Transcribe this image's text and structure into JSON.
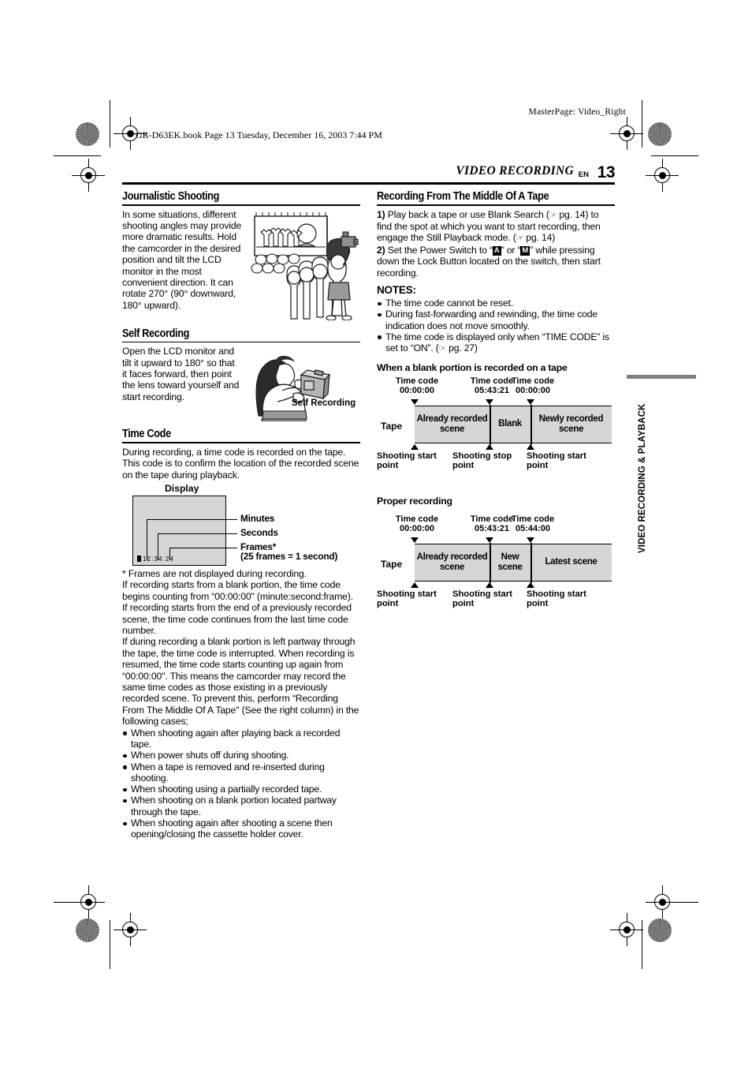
{
  "printer": {
    "masterpage": "MasterPage: Video_Right",
    "bookline": "GR-D63EK.book  Page 13  Tuesday, December 16, 2003  7:44 PM"
  },
  "header": {
    "title": "VIDEO RECORDING",
    "lang": "EN",
    "page_number": "13"
  },
  "sidetab": {
    "label": "VIDEO RECORDING & PLAYBACK",
    "color": "#808080"
  },
  "left_column": {
    "journalistic": {
      "heading": "Journalistic Shooting",
      "body": "In some situations, different shooting angles may provide more dramatic results. Hold the camcorder in the desired position and tilt the LCD monitor in the most convenient direction. It can rotate 270° (90° downward, 180° upward).",
      "illustration": "crowd-filming-illustration"
    },
    "self_recording": {
      "heading": "Self Recording",
      "body": "Open the LCD monitor and tilt it upward to 180° so that it faces forward, then point the lens toward yourself and start recording.",
      "illustration": "woman-with-camcorder-illustration",
      "caption": "Self Recording"
    },
    "time_code": {
      "heading": "Time Code",
      "intro": "During recording, a time code is recorded on the tape. This code is to confirm the location of the recorded scene on the tape during playback.",
      "display_label": "Display",
      "display_value": "12:34:24",
      "callouts": [
        {
          "label": "Minutes"
        },
        {
          "label": "Seconds"
        },
        {
          "label": "Frames*",
          "sub": "(25 frames = 1 second)"
        }
      ],
      "footnote": "*   Frames are not displayed during recording.",
      "para1": "If recording starts from a blank portion, the time code begins counting from “00:00:00\" (minute:second:frame). If recording starts from the end of a previously recorded scene, the time code continues from the last time code number.",
      "para2": "If during recording a blank portion is left partway through the tape, the time code is interrupted. When recording is resumed, the time code starts counting up again from “00:00:00\". This means the camcorder may record the same time codes as those existing in a previously recorded scene. To prevent this, perform “Recording From The Middle Of A Tape\" (See the right column) in the following cases;",
      "cases": [
        "When shooting again after playing back a recorded tape.",
        "When power shuts off during shooting.",
        "When a tape is removed and re-inserted during shooting.",
        "When shooting using a partially recorded tape.",
        "When shooting on a blank portion located partway through the tape.",
        "When shooting again after shooting a scene then opening/closing the cassette holder cover."
      ]
    }
  },
  "right_column": {
    "recording_middle": {
      "heading": "Recording From The Middle Of A Tape",
      "step1_num": "1)",
      "step1_a": " Play back a tape or use Blank Search (",
      "step1_b": " pg. 14) to find the spot at which you want to start recording, then engage the Still Playback mode. (",
      "step1_c": " pg. 14)",
      "step2_num": "2)",
      "step2_a": " Set the Power Switch to “",
      "step2_key1": "A",
      "step2_b": "” or “",
      "step2_key2": "M",
      "step2_c": "” while pressing down the Lock Button located on the switch, then start recording."
    },
    "notes": {
      "heading": "NOTES:",
      "items": [
        "The time code cannot be reset.",
        "During fast-forwarding and rewinding, the time code indication does not move smoothly."
      ],
      "item3_a": "The time code is displayed only when “TIME CODE” is set to “ON”. (",
      "item3_b": " pg. 27)"
    },
    "diagram_blank": {
      "heading": "When a blank portion is recorded on a tape",
      "tape_label": "Tape",
      "timecodes": [
        {
          "label": "Time code",
          "value": "00:00:00"
        },
        {
          "label": "Time code",
          "value": "05:43:21"
        },
        {
          "label": "Time code",
          "value": "00:00:00"
        }
      ],
      "cells": [
        "Already recorded scene",
        "Blank",
        "Newly recorded scene"
      ],
      "points": [
        "Shooting start point",
        "Shooting stop point",
        "Shooting start point"
      ]
    },
    "diagram_proper": {
      "heading": "Proper recording",
      "tape_label": "Tape",
      "timecodes": [
        {
          "label": "Time code",
          "value": "00:00:00"
        },
        {
          "label": "Time code",
          "value": "05:43:21"
        },
        {
          "label": "Time code",
          "value": "05:44:00"
        }
      ],
      "cells": [
        "Already recorded scene",
        "New scene",
        "Latest scene"
      ],
      "points": [
        "Shooting start point",
        "Shooting start point",
        "Shooting start point"
      ]
    }
  }
}
